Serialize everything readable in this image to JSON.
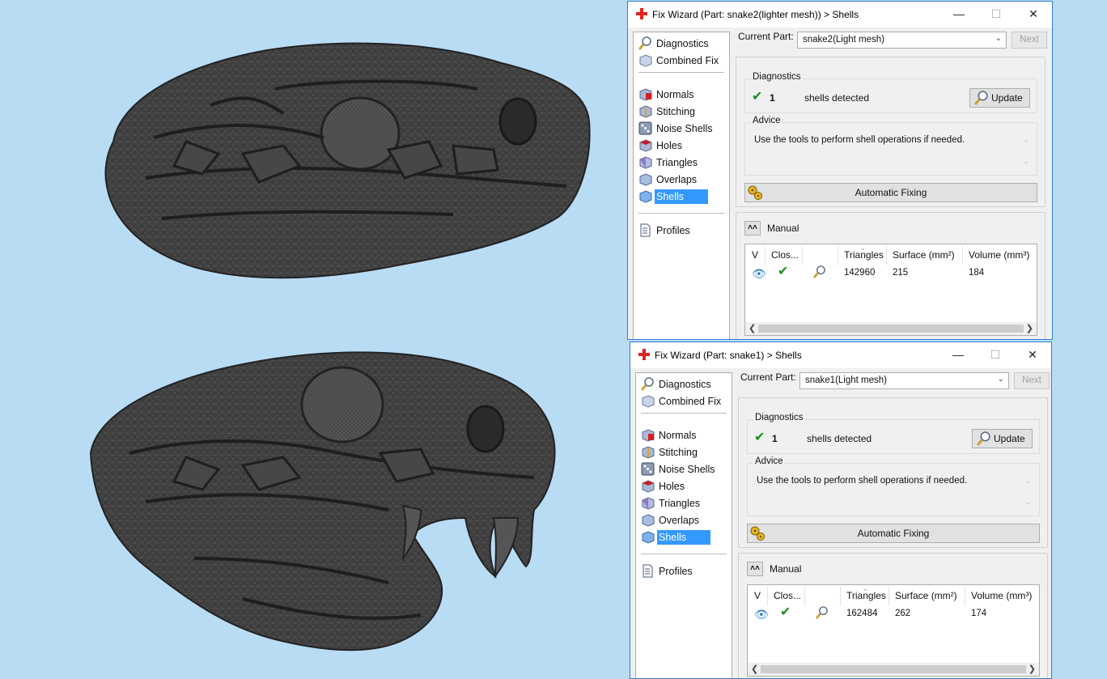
{
  "colors": {
    "accent": "#3399ff",
    "background": "#b9dcf5",
    "mesh": "#3a3a3a",
    "check": "#1e8f1e"
  },
  "windows": [
    {
      "title": "Fix Wizard (Part: snake2(lighter mesh)) > Shells",
      "nav": {
        "items": [
          {
            "label": "Diagnostics",
            "icon": "magnifier-icon"
          },
          {
            "label": "Combined Fix",
            "icon": "cube-icon"
          },
          {
            "label": "Normals",
            "icon": "cube-red-icon"
          },
          {
            "label": "Stitching",
            "icon": "cube-stitch-icon"
          },
          {
            "label": "Noise Shells",
            "icon": "dice-icon"
          },
          {
            "label": "Holes",
            "icon": "cube-hole-icon"
          },
          {
            "label": "Triangles",
            "icon": "cube-triangle-icon"
          },
          {
            "label": "Overlaps",
            "icon": "cube-overlap-icon"
          },
          {
            "label": "Shells",
            "icon": "cube-shell-icon",
            "selected": true
          }
        ],
        "profiles": "Profiles"
      },
      "current_part_label": "Current Part:",
      "current_part_value": "snake2(Light mesh)",
      "next_label": "Next",
      "diagnostics": {
        "title": "Diagnostics",
        "count": "1",
        "text": "shells detected",
        "update_label": "Update"
      },
      "advice": {
        "title": "Advice",
        "text": "Use the tools to perform shell operations if needed."
      },
      "auto_fix_label": "Automatic Fixing",
      "manual_label": "Manual",
      "table": {
        "headers": [
          "V",
          "Clos...",
          "",
          "Triangles",
          "Surface (mm²)",
          "Volume (mm³)"
        ],
        "rows": [
          {
            "triangles": "142960",
            "surface": "215",
            "volume": "184"
          }
        ]
      }
    },
    {
      "title": "Fix Wizard (Part: snake1) > Shells",
      "nav": {
        "items": [
          {
            "label": "Diagnostics",
            "icon": "magnifier-icon"
          },
          {
            "label": "Combined Fix",
            "icon": "cube-icon"
          },
          {
            "label": "Normals",
            "icon": "cube-red-icon"
          },
          {
            "label": "Stitching",
            "icon": "cube-stitch-icon"
          },
          {
            "label": "Noise Shells",
            "icon": "dice-icon"
          },
          {
            "label": "Holes",
            "icon": "cube-hole-icon"
          },
          {
            "label": "Triangles",
            "icon": "cube-triangle-icon"
          },
          {
            "label": "Overlaps",
            "icon": "cube-overlap-icon"
          },
          {
            "label": "Shells",
            "icon": "cube-shell-icon",
            "selected": true
          }
        ],
        "profiles": "Profiles"
      },
      "current_part_label": "Current Part:",
      "current_part_value": "snake1(Light mesh)",
      "next_label": "Next",
      "diagnostics": {
        "title": "Diagnostics",
        "count": "1",
        "text": "shells detected",
        "update_label": "Update"
      },
      "advice": {
        "title": "Advice",
        "text": "Use the tools to perform shell operations if needed."
      },
      "auto_fix_label": "Automatic Fixing",
      "manual_label": "Manual",
      "table": {
        "headers": [
          "V",
          "Clos...",
          "",
          "Triangles",
          "Surface (mm²)",
          "Volume (mm³)"
        ],
        "rows": [
          {
            "triangles": "162484",
            "surface": "262",
            "volume": "174"
          }
        ]
      }
    }
  ]
}
